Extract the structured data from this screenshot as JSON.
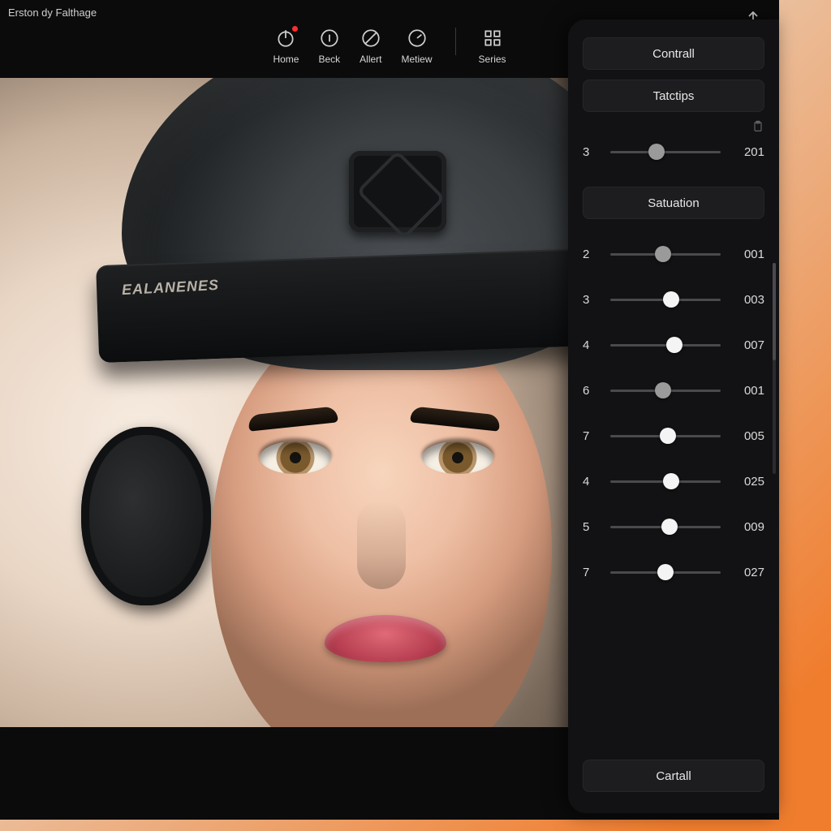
{
  "header": {
    "title": "Erston dy Falthage"
  },
  "toolbar": {
    "items": [
      {
        "name": "home",
        "label": "Home",
        "icon": "power",
        "notif": true
      },
      {
        "name": "back",
        "label": "Beck",
        "icon": "circle-i",
        "notif": false
      },
      {
        "name": "alert",
        "label": "Allert",
        "icon": "slash",
        "notif": false
      },
      {
        "name": "metiew",
        "label": "Metiew",
        "icon": "gauge",
        "notif": false
      },
      {
        "name": "series",
        "label": "Series",
        "icon": "grid",
        "notif": false
      }
    ]
  },
  "canvas": {
    "helmet_label": "EALANENES"
  },
  "panel": {
    "top_buttons": [
      {
        "name": "contrall",
        "label": "Contrall"
      },
      {
        "name": "tatctips",
        "label": "Tatctips"
      }
    ],
    "first_slider": {
      "left": "3",
      "right": "201",
      "pos": 42,
      "dim": true
    },
    "section_label": "Satuation",
    "sliders": [
      {
        "left": "2",
        "right": "001",
        "pos": 48,
        "dim": true
      },
      {
        "left": "3",
        "right": "003",
        "pos": 55,
        "dim": false
      },
      {
        "left": "4",
        "right": "007",
        "pos": 58,
        "dim": false
      },
      {
        "left": "6",
        "right": "001",
        "pos": 48,
        "dim": true
      },
      {
        "left": "7",
        "right": "005",
        "pos": 52,
        "dim": false
      },
      {
        "left": "4",
        "right": "025",
        "pos": 55,
        "dim": false
      },
      {
        "left": "5",
        "right": "009",
        "pos": 54,
        "dim": false
      },
      {
        "left": "7",
        "right": "027",
        "pos": 50,
        "dim": false
      }
    ],
    "footer_button": {
      "name": "cartall",
      "label": "Cartall"
    }
  }
}
